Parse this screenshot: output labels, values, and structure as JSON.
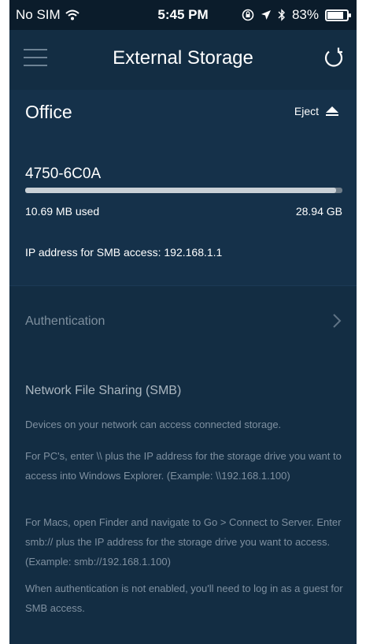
{
  "status_bar": {
    "carrier": "No SIM",
    "time": "5:45 PM",
    "battery": "83%",
    "battery_level": 0.83
  },
  "header": {
    "title": "External Storage"
  },
  "storage": {
    "location": "Office",
    "eject_label": "Eject",
    "device_name": "4750-6C0A",
    "used": "10.69 MB used",
    "capacity": "28.94 GB",
    "usage_fraction": 0.98,
    "ip_text": "IP address for SMB access: 192.168.1.1"
  },
  "authentication": {
    "label": "Authentication"
  },
  "smb": {
    "title": "Network File Sharing (SMB)",
    "paragraphs": [
      "Devices on your network can access connected storage.",
      "For PC's, enter \\\\ plus the IP address for the storage drive you want to access into Windows Explorer. (Example: \\\\192.168.1.100)",
      "For Macs, open Finder and navigate to Go > Connect to Server. Enter smb:// plus the IP address for the storage drive you want to access. (Example: smb://192.168.1.100)",
      "When authentication is not enabled, you'll need to log in as a guest for SMB access."
    ]
  },
  "colors": {
    "background": "#132d43",
    "status_bar": "#0b1c2b",
    "muted_text": "#7f90a0"
  }
}
